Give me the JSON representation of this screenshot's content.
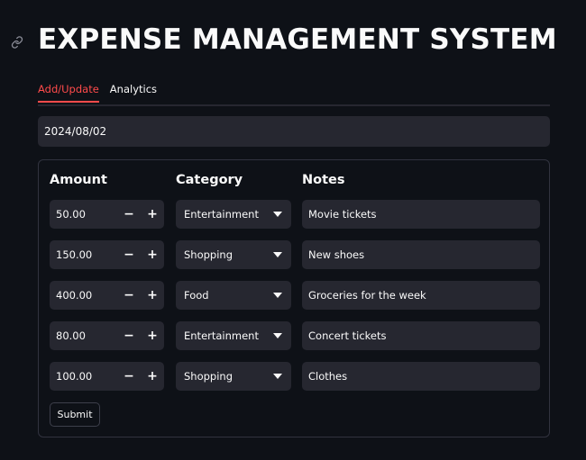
{
  "app": {
    "title": "EXPENSE MANAGEMENT SYSTEM"
  },
  "tabs": [
    {
      "label": "Add/Update",
      "active": true
    },
    {
      "label": "Analytics",
      "active": false
    }
  ],
  "date_input": {
    "value": "2024/08/02"
  },
  "form": {
    "headers": {
      "amount": "Amount",
      "category": "Category",
      "notes": "Notes"
    },
    "rows": [
      {
        "amount": "50.00",
        "category": "Entertainment",
        "notes": "Movie tickets"
      },
      {
        "amount": "150.00",
        "category": "Shopping",
        "notes": "New shoes"
      },
      {
        "amount": "400.00",
        "category": "Food",
        "notes": "Groceries for the week"
      },
      {
        "amount": "80.00",
        "category": "Entertainment",
        "notes": "Concert tickets"
      },
      {
        "amount": "100.00",
        "category": "Shopping",
        "notes": "Clothes"
      }
    ],
    "stepper": {
      "minus": "−",
      "plus": "+"
    },
    "submit_label": "Submit"
  },
  "colors": {
    "background": "#0e1117",
    "input_background": "#262730",
    "accent": "#ff4b4b",
    "text": "#fafafa"
  },
  "icons": {
    "anchor": "link-icon",
    "dropdown": "chevron-down-icon"
  }
}
